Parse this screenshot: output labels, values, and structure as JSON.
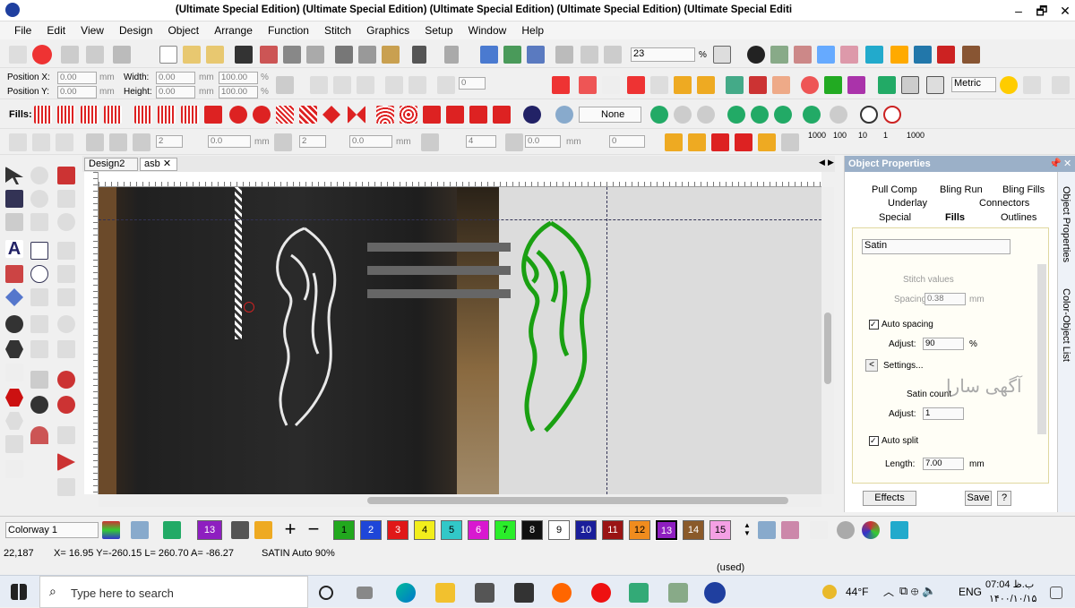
{
  "window": {
    "title": "(Ultimate Special Edition) (Ultimate Special Edition) (Ultimate Special Edition) (Ultimate Special Edition) (Ultimate Special Editi",
    "minimize": "–",
    "maximize": "🗗",
    "close": "✕"
  },
  "menu": [
    "File",
    "Edit",
    "View",
    "Design",
    "Object",
    "Arrange",
    "Function",
    "Stitch",
    "Graphics",
    "Setup",
    "Window",
    "Help"
  ],
  "toolbar1": {
    "zoom": "23",
    "zoom_unit": "%"
  },
  "toolbar2": {
    "pos_x_label": "Position X:",
    "pos_y_label": "Position Y:",
    "pos_x": "0.00",
    "pos_y": "0.00",
    "width_label": "Width:",
    "height_label": "Height:",
    "width": "0.00",
    "height": "0.00",
    "unit": "mm",
    "scale_w": "100.00",
    "scale_h": "100.00",
    "pct": "%",
    "rot": "0",
    "units_select": "Metric"
  },
  "toolbar3": {
    "fills_label": "Fills:",
    "none_select": "None"
  },
  "toolbar4": {
    "v1": "2",
    "v2": "0.0",
    "v3": "2",
    "v4": "0.0",
    "v5": "4",
    "v6": "0.0",
    "v7": "0",
    "unit": "mm",
    "n1000a": "1000",
    "n100": "100",
    "n10": "10",
    "n1": "1",
    "n1000b": "1000"
  },
  "tabs": [
    "Design2",
    "asb"
  ],
  "panel": {
    "title": "Object Properties",
    "tabs_row1": [
      "Pull Comp",
      "Bling Run",
      "Bling Fills"
    ],
    "tabs_row2": [
      "Underlay",
      "Connectors"
    ],
    "tabs_row3": [
      "Special",
      "Fills",
      "Outlines"
    ],
    "fill_type": "Satin",
    "stitch_values": "Stitch values",
    "spacing_label": "Spacing:",
    "spacing": "0.38",
    "spacing_unit": "mm",
    "auto_spacing": "Auto spacing",
    "adjust_label": "Adjust:",
    "adjust": "90",
    "adjust_unit": "%",
    "settings": "Settings...",
    "satin_count": "Satin count",
    "adjust2_label": "Adjust:",
    "adjust2": "1",
    "auto_split": "Auto split",
    "length_label": "Length:",
    "length": "7.00",
    "length_unit": "mm",
    "effects": "Effects",
    "save": "Save",
    "help": "?",
    "watermark": "آگهی سارا"
  },
  "sidebar": [
    "Object Properties",
    "Color-Object List"
  ],
  "colorway": {
    "label": "Colorway 1"
  },
  "swatches": [
    {
      "n": "13",
      "c": "#8e1ec0",
      "fg": "#fff"
    },
    {
      "n": "1",
      "c": "#22a81e",
      "fg": "#000"
    },
    {
      "n": "2",
      "c": "#1e46d8",
      "fg": "#fff"
    },
    {
      "n": "3",
      "c": "#e01818",
      "fg": "#fff"
    },
    {
      "n": "4",
      "c": "#f2ee1c",
      "fg": "#000"
    },
    {
      "n": "5",
      "c": "#32c8c8",
      "fg": "#000"
    },
    {
      "n": "6",
      "c": "#d818d0",
      "fg": "#fff"
    },
    {
      "n": "7",
      "c": "#2aee2a",
      "fg": "#000"
    },
    {
      "n": "8",
      "c": "#101010",
      "fg": "#fff"
    },
    {
      "n": "9",
      "c": "#ffffff",
      "fg": "#000"
    },
    {
      "n": "10",
      "c": "#1a1e9a",
      "fg": "#fff"
    },
    {
      "n": "11",
      "c": "#9a1414",
      "fg": "#fff"
    },
    {
      "n": "12",
      "c": "#f08c1e",
      "fg": "#000"
    },
    {
      "n": "13",
      "c": "#8e1ec0",
      "fg": "#fff"
    },
    {
      "n": "14",
      "c": "#8a5a2a",
      "fg": "#fff"
    },
    {
      "n": "15",
      "c": "#f4a0e4",
      "fg": "#000"
    }
  ],
  "status": {
    "coords": "22,187",
    "measure": "X=  16.95 Y=-260.15 L= 260.70 A= -86.27",
    "stitch": "SATIN Auto 90%",
    "used": "(used)"
  },
  "taskbar": {
    "search": "Type here to search",
    "weather": "44°F",
    "lang": "ENG",
    "time": "07:04 ب.ظ",
    "date": "۱۴۰۰/۱۰/۱۵"
  }
}
